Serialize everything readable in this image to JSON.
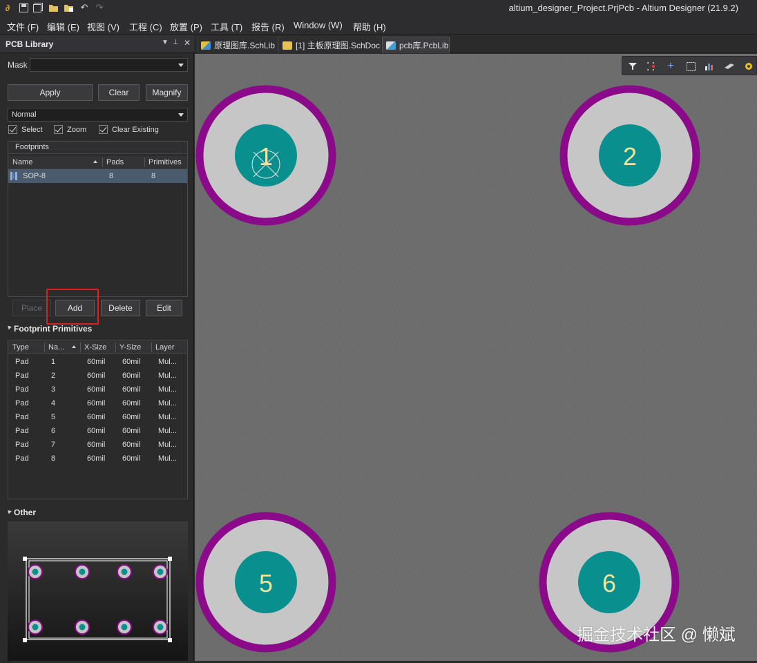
{
  "window": {
    "title": "altium_designer_Project.PrjPcb - Altium Designer (21.9.2)"
  },
  "menu": [
    "文件 (F)",
    "编辑 (E)",
    "视图 (V)",
    "工程 (C)",
    "放置 (P)",
    "工具 (T)",
    "报告 (R)",
    "Window (W)",
    "帮助 (H)"
  ],
  "panel": {
    "title": "PCB Library",
    "mask_label": "Mask",
    "mask_value": "",
    "buttons": {
      "apply": "Apply",
      "clear": "Clear",
      "magnify": "Magnify"
    },
    "mode_value": "Normal",
    "checkboxes": {
      "select": "Select",
      "zoom": "Zoom",
      "clear_existing": "Clear Existing"
    },
    "footprints": {
      "title": "Footprints",
      "columns": [
        "Name",
        "Pads",
        "Primitives"
      ],
      "rows": [
        {
          "name": "SOP-8",
          "pads": "8",
          "primitives": "8"
        }
      ]
    },
    "footprint_buttons": {
      "place": "Place",
      "add": "Add",
      "delete": "Delete",
      "edit": "Edit"
    },
    "primitives": {
      "title": "Footprint Primitives",
      "columns": [
        "Type",
        "Na...",
        "X-Size",
        "Y-Size",
        "Layer"
      ],
      "rows": [
        {
          "type": "Pad",
          "name": "1",
          "x": "60mil",
          "y": "60mil",
          "layer": "Mul..."
        },
        {
          "type": "Pad",
          "name": "2",
          "x": "60mil",
          "y": "60mil",
          "layer": "Mul..."
        },
        {
          "type": "Pad",
          "name": "3",
          "x": "60mil",
          "y": "60mil",
          "layer": "Mul..."
        },
        {
          "type": "Pad",
          "name": "4",
          "x": "60mil",
          "y": "60mil",
          "layer": "Mul..."
        },
        {
          "type": "Pad",
          "name": "5",
          "x": "60mil",
          "y": "60mil",
          "layer": "Mul..."
        },
        {
          "type": "Pad",
          "name": "6",
          "x": "60mil",
          "y": "60mil",
          "layer": "Mul..."
        },
        {
          "type": "Pad",
          "name": "7",
          "x": "60mil",
          "y": "60mil",
          "layer": "Mul..."
        },
        {
          "type": "Pad",
          "name": "8",
          "x": "60mil",
          "y": "60mil",
          "layer": "Mul..."
        }
      ]
    },
    "other_title": "Other"
  },
  "tabs": [
    {
      "label": "原理图库.SchLib",
      "active": false
    },
    {
      "label": "[1] 主板原理图.SchDoc",
      "active": false
    },
    {
      "label": "pcb库.PcbLib",
      "active": true
    }
  ],
  "canvas": {
    "pads": [
      "1",
      "2",
      "5",
      "6"
    ],
    "colors": {
      "ring": "#8a0a8a",
      "copper": "#c6c6c6",
      "hole": "#0a8f8f",
      "label": "#f0e39a",
      "background": "#6e6d6e"
    }
  },
  "watermark": "掘金技术社区 @ 懒斌"
}
